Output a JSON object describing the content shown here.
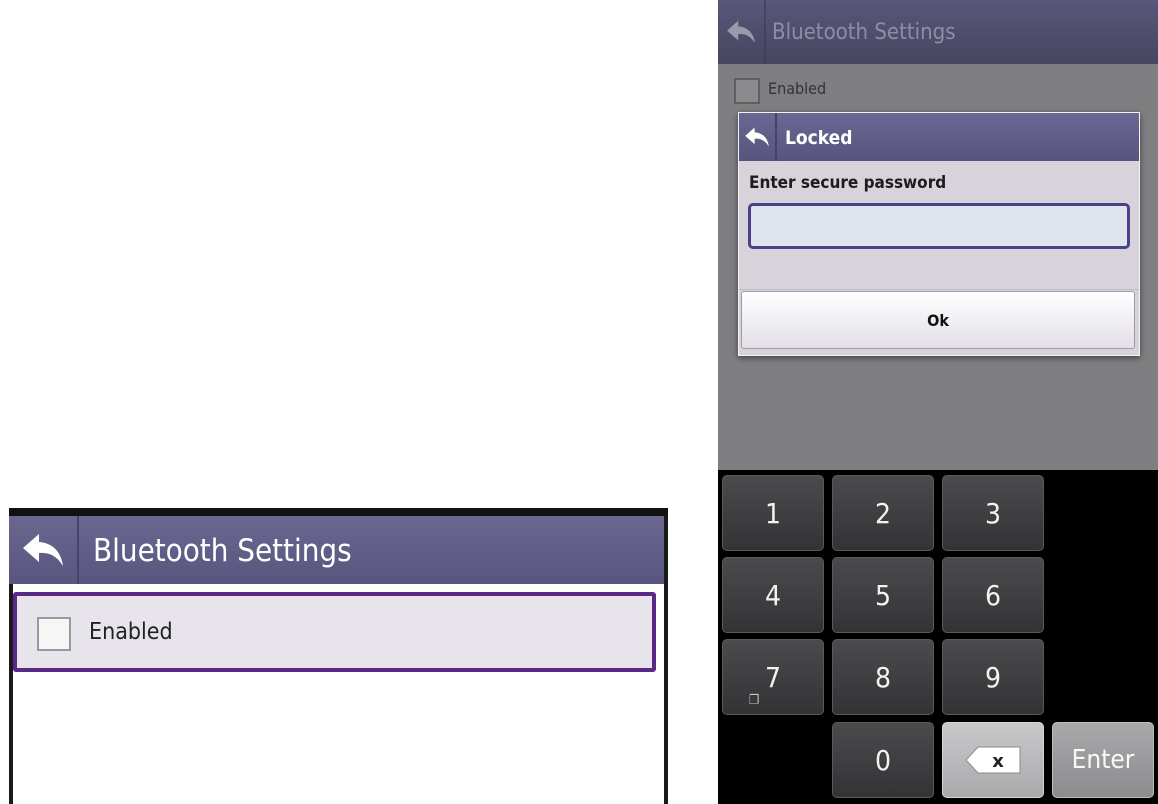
{
  "left_screen": {
    "title": "Bluetooth Settings",
    "enabled_label": "Enabled",
    "enabled_checked": false,
    "back_icon": "back-arrow-icon"
  },
  "right_screen": {
    "title": "Bluetooth Settings",
    "enabled_label": "Enabled",
    "enabled_checked": false,
    "dialog": {
      "title": "Locked",
      "prompt": "Enter secure password",
      "password_value": "",
      "ok_label": "Ok"
    },
    "keypad": {
      "k1": "1",
      "k2": "2",
      "k3": "3",
      "k4": "4",
      "k5": "5",
      "k6": "6",
      "k7": "7",
      "k8": "8",
      "k9": "9",
      "k0": "0",
      "backspace_glyph": "x",
      "enter": "Enter"
    }
  },
  "colors": {
    "header": "#5f5c86",
    "selection_border": "#5a2886",
    "input_border": "#4a4288",
    "key_dark": "#3d3d3f"
  }
}
